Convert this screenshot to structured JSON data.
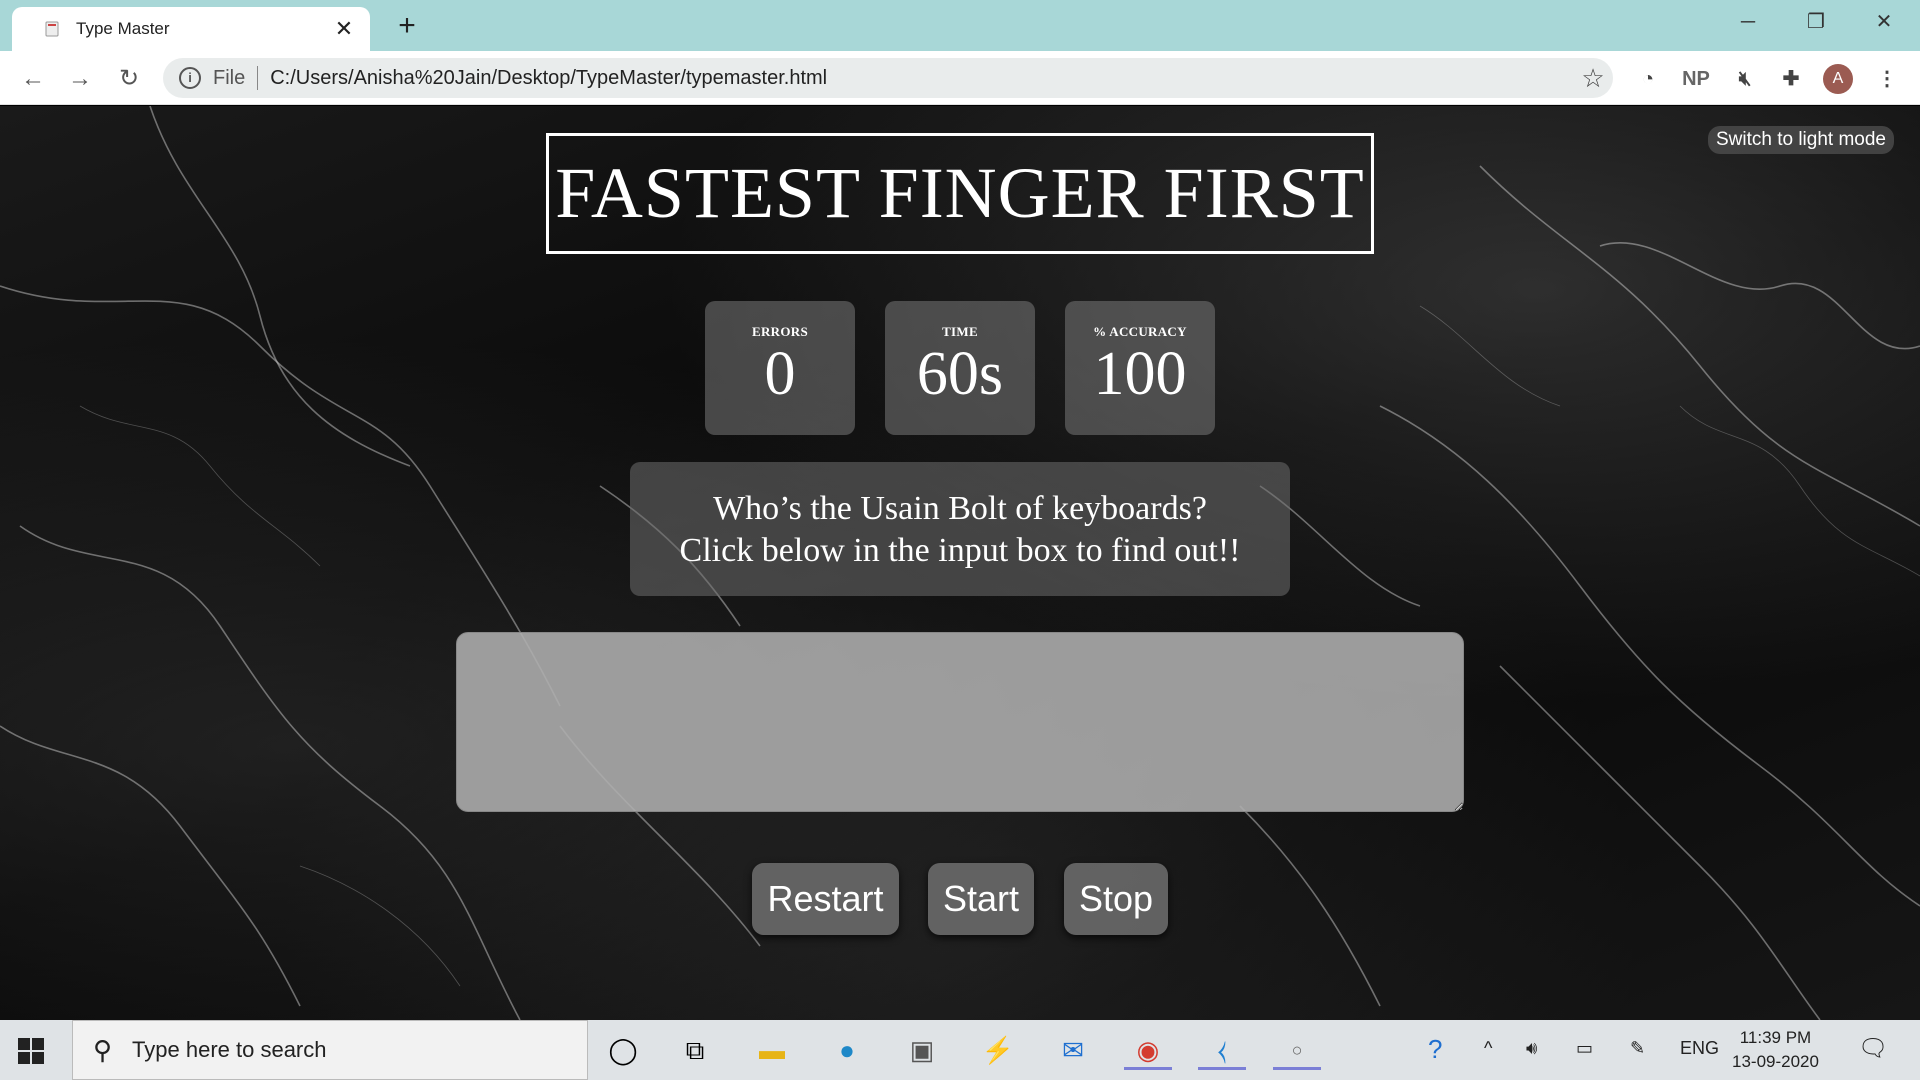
{
  "browser": {
    "tab_title": "Type Master",
    "new_tab": "+",
    "omnibox": {
      "info_icon": "info-icon",
      "scheme_label": "File",
      "url": "C:/Users/Anisha%20Jain/Desktop/TypeMaster/typemaster.html"
    },
    "extensions": [
      "speed-icon",
      "NP",
      "mute-icon",
      "puzzle-icon"
    ],
    "profile_initial": "A"
  },
  "page": {
    "mode_toggle": "Switch to light mode",
    "title": "FASTEST FINGER FIRST",
    "stats": [
      {
        "label": "ERRORS",
        "value": "0"
      },
      {
        "label": "TIME",
        "value": "60s"
      },
      {
        "label": "% ACCURACY",
        "value": "100"
      }
    ],
    "quote_line1": "Who’s the Usain Bolt of keyboards?",
    "quote_line2": "Click below in the input box to find out!!",
    "input_value": "",
    "buttons": {
      "restart": "Restart",
      "start": "Start",
      "stop": "Stop"
    }
  },
  "taskbar": {
    "search_placeholder": "Type here to search",
    "language": "ENG",
    "time": "11:39 PM",
    "date": "13-09-2020"
  }
}
